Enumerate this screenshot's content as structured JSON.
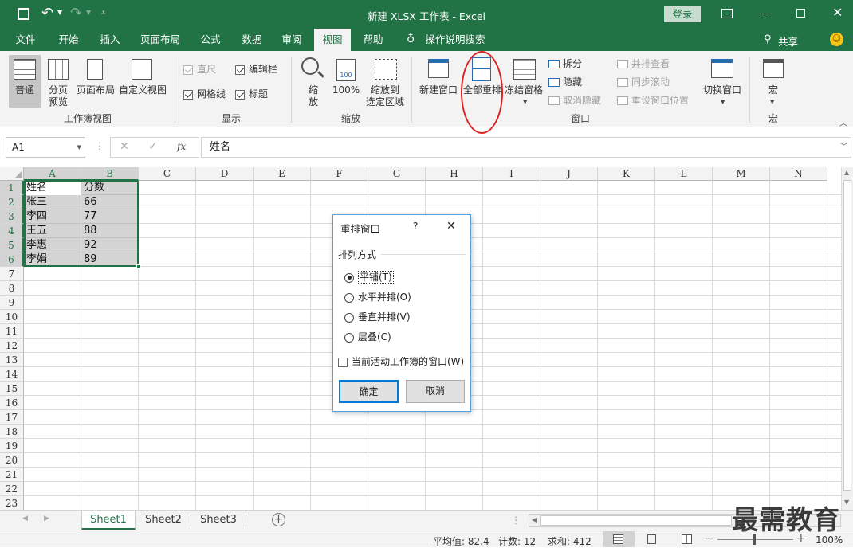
{
  "window": {
    "title": "新建 XLSX 工作表  -  Excel",
    "login_label": "登录"
  },
  "tabs": [
    "文件",
    "开始",
    "插入",
    "页面布局",
    "公式",
    "数据",
    "审阅",
    "视图",
    "帮助",
    "操作说明搜索"
  ],
  "active_tab": "视图",
  "share_label": "共享",
  "ribbon": {
    "workbook_views": {
      "group_label": "工作簿视图",
      "normal": "普通",
      "page_break_1": "分页",
      "page_break_2": "预览",
      "page_layout": "页面布局",
      "custom_view": "自定义视图"
    },
    "show": {
      "group_label": "显示",
      "ruler": "直尺",
      "formula_bar": "编辑栏",
      "gridlines": "网格线",
      "headings": "标题"
    },
    "zoom": {
      "group_label": "缩放",
      "zoom_1": "缩",
      "zoom_2": "放",
      "zoom100": "100%",
      "zoom_sel_1": "缩放到",
      "zoom_sel_2": "选定区域"
    },
    "window": {
      "group_label": "窗口",
      "new_window": "新建窗口",
      "arrange_all": "全部重排",
      "freeze": "冻结窗格",
      "split": "拆分",
      "hide": "隐藏",
      "unhide": "取消隐藏",
      "side_by_side": "并排查看",
      "sync_scroll": "同步滚动",
      "reset_pos": "重设窗口位置",
      "switch": "切换窗口"
    },
    "macros": {
      "group_label": "宏",
      "macros": "宏"
    }
  },
  "formula_bar": {
    "name_box": "A1",
    "fx": "fx",
    "content": "姓名"
  },
  "columns": [
    "A",
    "B",
    "C",
    "D",
    "E",
    "F",
    "G",
    "H",
    "I",
    "J",
    "K",
    "L",
    "M",
    "N"
  ],
  "rows": [
    "1",
    "2",
    "3",
    "4",
    "5",
    "6",
    "7",
    "8",
    "9",
    "10",
    "11",
    "12",
    "13",
    "14",
    "15",
    "16",
    "17",
    "18",
    "19",
    "20",
    "21",
    "22",
    "23"
  ],
  "cells": [
    [
      "姓名",
      "分数"
    ],
    [
      "张三",
      "66"
    ],
    [
      "李四",
      "77"
    ],
    [
      "王五",
      "88"
    ],
    [
      "李惠",
      "92"
    ],
    [
      "李娟",
      "89"
    ]
  ],
  "dialog": {
    "title": "重排窗口",
    "help": "?",
    "close": "✕",
    "section": "排列方式",
    "options": [
      "平铺(T)",
      "水平并排(O)",
      "垂直并排(V)",
      "层叠(C)"
    ],
    "selected_option": "平铺(T)",
    "checkbox": "当前活动工作簿的窗口(W)",
    "ok": "确定",
    "cancel": "取消"
  },
  "sheets": [
    "Sheet1",
    "Sheet2",
    "Sheet3"
  ],
  "active_sheet": "Sheet1",
  "status": {
    "average": "平均值: 82.4",
    "count": "计数: 12",
    "sum": "求和: 412",
    "zoom": "100%"
  },
  "watermark": "最需教育",
  "colors": {
    "excel_green": "#217346",
    "annotation_red": "#e02020"
  }
}
